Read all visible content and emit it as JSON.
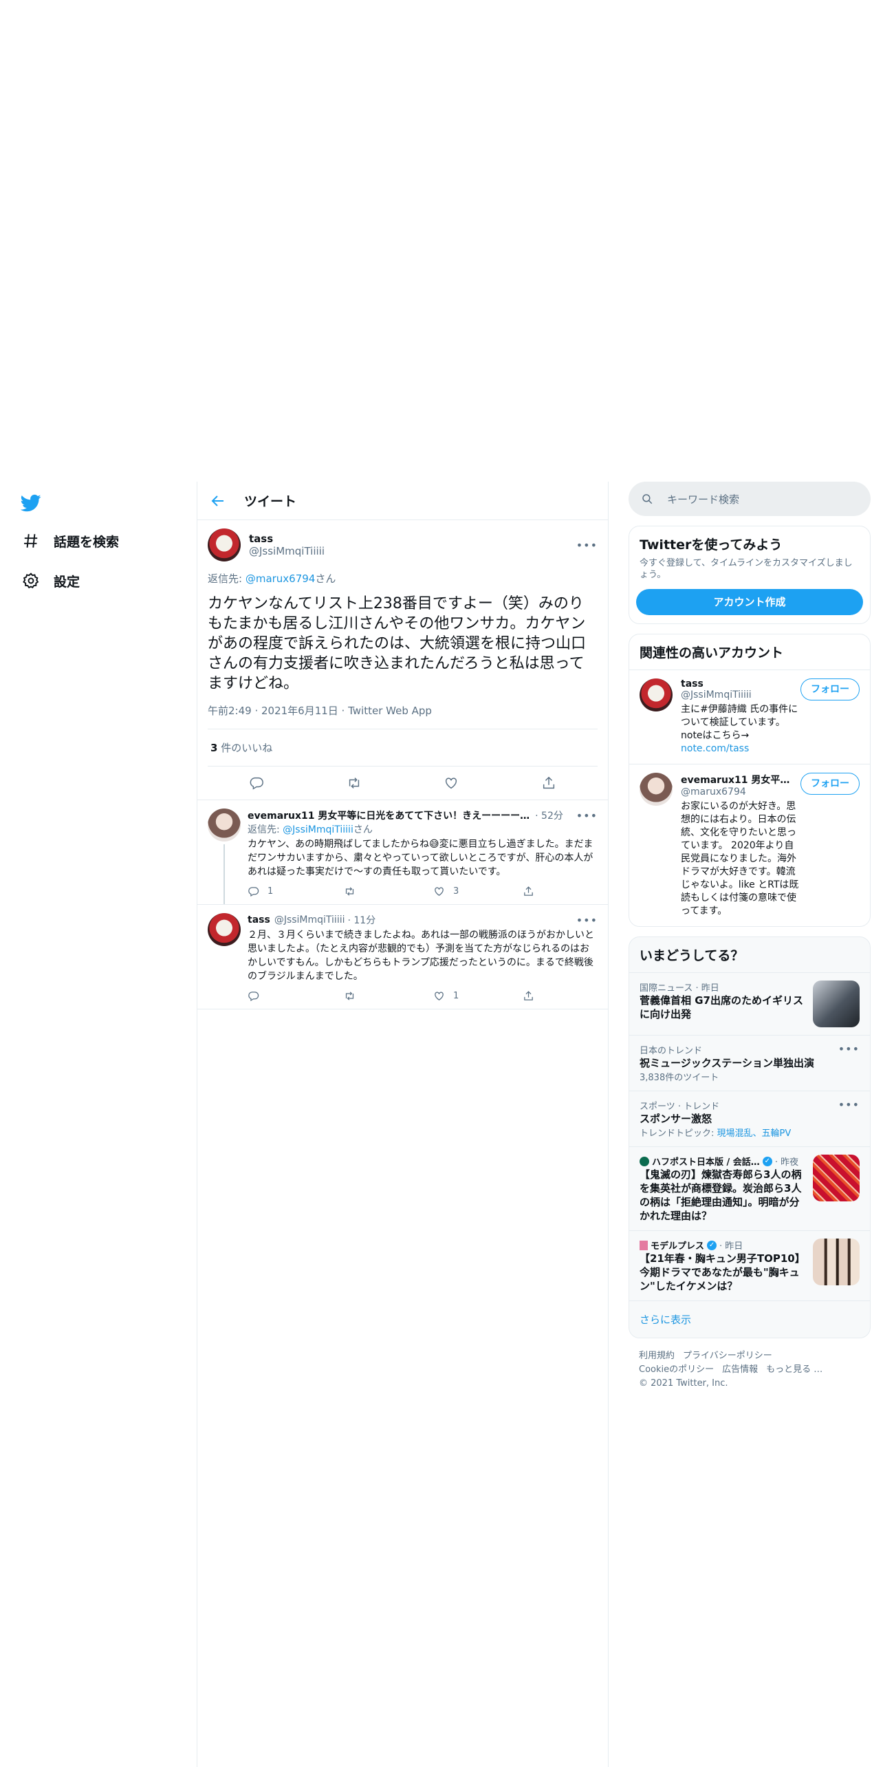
{
  "sidebar": {
    "explore_label": "話題を検索",
    "settings_label": "設定"
  },
  "header": {
    "title": "ツイート"
  },
  "main_tweet": {
    "name": "tass",
    "handle": "@JssiMmqiTiiiii",
    "reply_prefix": "返信先: ",
    "reply_to": "@marux6794",
    "reply_suffix": "さん",
    "text": "カケヤンなんてリスト上238番目ですよー（笑）みのりもたまかも居るし江川さんやその他ワンサカ。カケヤンがあの程度で訴えられたのは、大統領選を根に持つ山口さんの有力支援者に吹き込まれたんだろうと私は思ってますけどね。",
    "meta": "午前2:49 · 2021年6月11日 · Twitter Web App",
    "likes_count": "3",
    "likes_label": " 件のいいね"
  },
  "replies": [
    {
      "name": "evemarux11 男女平等に日光をあてて下さい！きえーーーー…",
      "time": "· 52分",
      "reply_prefix": "返信先: ",
      "reply_to": "@JssiMmqiTiiiii",
      "reply_suffix": "さん",
      "text": "カケヤン、あの時期飛ばしてましたからね😅変に悪目立ちし過ぎました。まだまだワンサカいますから、粛々とやっていって欲しいところですが、肝心の本人があれは疑った事実だけで〜すの責任も取って貰いたいです。",
      "reply_count": "1",
      "retweet_count": "",
      "like_count": "3"
    },
    {
      "name": "tass",
      "handle": "@JssiMmqiTiiiii",
      "time": "· 11分",
      "text": "２月、３月くらいまで続きましたよね。あれは一部の戦勝派のほうがおかしいと思いましたよ。（たとえ内容が悲観的でも）予測を当てた方がなじられるのはおかしいですもん。しかもどちらもトランプ応援だったというのに。まるで終戦後のブラジルまんまでした。",
      "reply_count": "",
      "retweet_count": "",
      "like_count": "1"
    }
  ],
  "search": {
    "placeholder": "キーワード検索"
  },
  "signup": {
    "title": "Twitterを使ってみよう",
    "desc": "今すぐ登録して、タイムラインをカスタマイズしましょう。",
    "button": "アカウント作成"
  },
  "relevant": {
    "title": "関連性の高いアカウント",
    "follow_label": "フォロー",
    "accounts": [
      {
        "name": "tass",
        "handle": "@JssiMmqiTiiiii",
        "bio": "主に#伊藤詩織 氏の事件について検証しています。 noteはこちら→",
        "link": "note.com/tass"
      },
      {
        "name": "evemarux11 男女平…",
        "handle": "@marux6794",
        "bio": "お家にいるのが大好き。思想的には右より。日本の伝統、文化を守りたいと思っています。 2020年より自民党員になりました。海外ドラマが大好きです。韓流じゃないよ。like とRTは既読もしくは付箋の意味で使ってます。"
      }
    ]
  },
  "trends": {
    "title": "いまどうしてる？",
    "items": [
      {
        "context": "国際ニュース · 昨日",
        "title": "菅義偉首相 G7出席のためイギリスに向け出発"
      },
      {
        "context": "日本のトレンド",
        "title": "祝ミュージックステーション単独出演",
        "count": "3,838件のツイート"
      },
      {
        "context": "スポーツ · トレンド",
        "title": "スポンサー激怒",
        "topics_label": "トレンドトピック: ",
        "topics": "現場混乱、五輪PV"
      },
      {
        "context": "ハフポスト日本版 / 会話…",
        "time": "· 昨夜",
        "title": "【鬼滅の刃】煉獄杏寿郎ら3人の柄を集英社が商標登録。炭治郎ら3人の柄は「拒絶理由通知」。明暗が分かれた理由は？"
      },
      {
        "context": "モデルプレス",
        "time": "· 昨日",
        "title": "【21年春・胸キュン男子TOP10】今期ドラマであなたが最も\"胸キュン\"したイケメンは？"
      }
    ],
    "show_more": "さらに表示"
  },
  "footer": {
    "links": [
      "利用規約",
      "プライバシーポリシー",
      "Cookieのポリシー",
      "広告情報",
      "もっと見る …"
    ],
    "copyright": "© 2021 Twitter, Inc."
  },
  "colors": {
    "accent": "#1da1f2",
    "link": "#1b95e0",
    "muted": "#5b7083"
  }
}
